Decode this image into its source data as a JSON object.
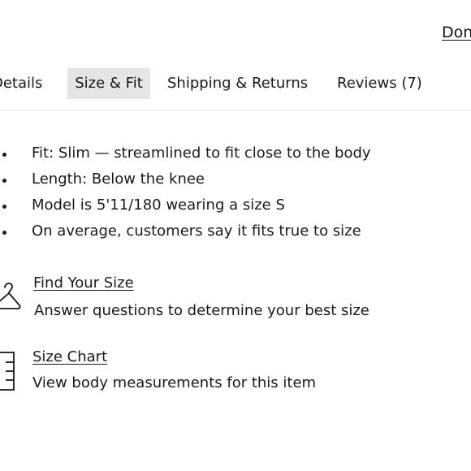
{
  "header": {
    "done_label": "Done"
  },
  "tabs": [
    {
      "label": "Details"
    },
    {
      "label": "Size & Fit",
      "active": true
    },
    {
      "label": "Shipping & Returns"
    },
    {
      "label": "Reviews (7)"
    }
  ],
  "fit": {
    "items": [
      "Fit: Slim — streamlined to fit close to the body",
      "Length: Below the knee",
      "Model is 5'11/180 wearing a size S",
      "On average, customers say it fits true to size"
    ]
  },
  "find_size": {
    "icon": "hanger-icon",
    "link": "Find Your Size",
    "description": "Answer questions to determine your best size"
  },
  "size_chart": {
    "icon": "size-chart-icon",
    "link": "Size Chart",
    "description": "View body measurements for this item"
  }
}
